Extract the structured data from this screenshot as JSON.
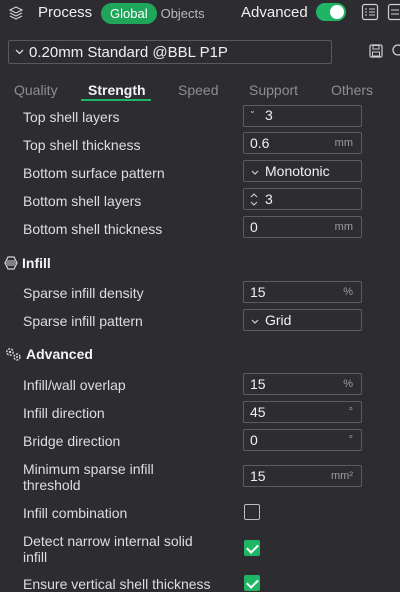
{
  "header": {
    "title": "Process",
    "scope_global": "Global",
    "scope_objects": "Objects",
    "advanced_label": "Advanced",
    "advanced_on": true
  },
  "preset": {
    "name": "0.20mm Standard @BBL P1P"
  },
  "tabs": [
    {
      "label": "Quality",
      "active": false
    },
    {
      "label": "Strength",
      "active": true
    },
    {
      "label": "Speed",
      "active": false
    },
    {
      "label": "Support",
      "active": false
    },
    {
      "label": "Others",
      "active": false
    }
  ],
  "rows": {
    "top_shell_layers": {
      "label": "Top shell layers",
      "value": "3"
    },
    "top_shell_thickness": {
      "label": "Top shell thickness",
      "value": "0.6",
      "unit": "mm"
    },
    "bottom_surface_pattern": {
      "label": "Bottom surface pattern",
      "value": "Monotonic"
    },
    "bottom_shell_layers": {
      "label": "Bottom shell layers",
      "value": "3"
    },
    "bottom_shell_thickness": {
      "label": "Bottom shell thickness",
      "value": "0",
      "unit": "mm"
    }
  },
  "infill": {
    "title": "Infill",
    "density": {
      "label": "Sparse infill density",
      "value": "15",
      "unit": "%"
    },
    "pattern": {
      "label": "Sparse infill pattern",
      "value": "Grid"
    }
  },
  "advanced": {
    "title": "Advanced",
    "overlap": {
      "label": "Infill/wall overlap",
      "value": "15",
      "unit": "%"
    },
    "infill_direction": {
      "label": "Infill direction",
      "value": "45",
      "unit": "°"
    },
    "bridge_direction": {
      "label": "Bridge direction",
      "value": "0",
      "unit": "°"
    },
    "min_sparse_line1": "Minimum sparse infill",
    "min_sparse_line2": "threshold",
    "min_sparse_value": "15",
    "min_sparse_unit": "mm²",
    "infill_combination": {
      "label": "Infill combination",
      "checked": false
    },
    "detect_line1": "Detect narrow internal solid",
    "detect_line2": "infill",
    "detect_checked": true,
    "ensure_vertical": {
      "label": "Ensure vertical shell thickness",
      "checked": true
    }
  },
  "colors": {
    "accent": "#1fb565",
    "background": "#2d2d31"
  }
}
